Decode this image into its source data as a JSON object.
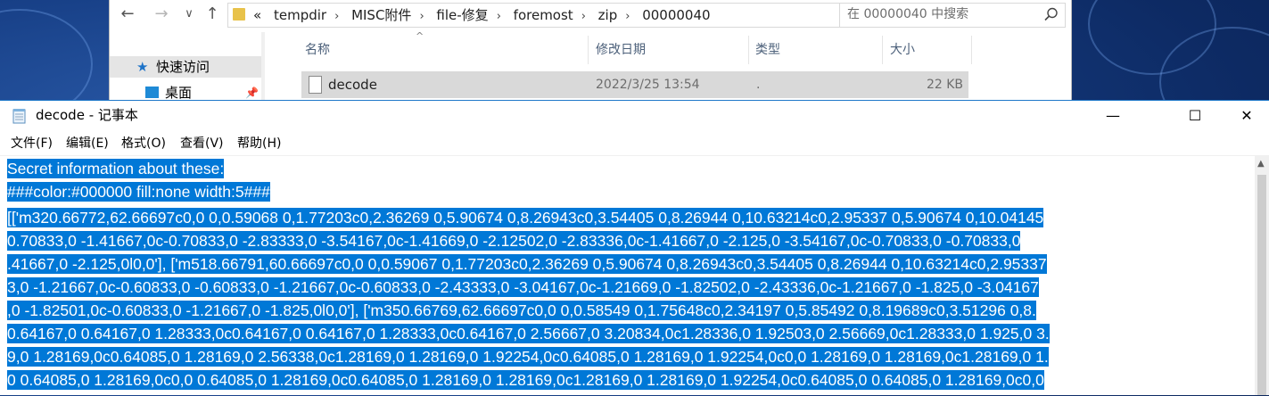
{
  "explorer": {
    "nav": {
      "back": "←",
      "forward": "→",
      "recent": "∨",
      "up": "↑"
    },
    "breadcrumb": [
      "«",
      "tempdir",
      "MISC附件",
      "file-修复",
      "foremost",
      "zip",
      "00000040"
    ],
    "search_placeholder": "在 00000040 中搜索",
    "sidebar": [
      {
        "label": "快速访问",
        "icon": "star-icon"
      },
      {
        "label": "桌面",
        "icon": "desktop-icon"
      }
    ],
    "columns": {
      "name": "名称",
      "modified": "修改日期",
      "type": "类型",
      "size": "大小"
    },
    "files": [
      {
        "name": "decode",
        "modified": "2022/3/25 13:54",
        "type": ".",
        "size": "22 KB"
      }
    ]
  },
  "notepad": {
    "title": "decode - 记事本",
    "controls": {
      "minimize": "—",
      "maximize": "☐",
      "close": "✕"
    },
    "menu": [
      "文件(F)",
      "编辑(E)",
      "格式(O)",
      "查看(V)",
      "帮助(H)"
    ],
    "lines": [
      "Secret information about these:",
      "###color:#000000 fill:none width:5###",
      "[['m320.66772,62.66697c0,0 0,0.59068 0,1.77203c0,2.36269 0,5.90674 0,8.26943c0,3.54405 0,8.26944 0,10.63214c0,2.95337 0,5.90674 0,10.04145",
      "0.70833,0 -1.41667,0c-0.70833,0 -2.83333,0 -3.54167,0c-1.41669,0 -2.12502,0 -2.83336,0c-1.41667,0 -2.125,0 -3.54167,0c-0.70833,0 -0.70833,0",
      ".41667,0 -2.125,0l0,0'], ['m518.66791,60.66697c0,0 0,0.59067 0,1.77203c0,2.36269 0,5.90674 0,8.26943c0,3.54405 0,8.26944 0,10.63214c0,2.95337",
      "3,0 -1.21667,0c-0.60833,0 -0.60833,0 -1.21667,0c-0.60833,0 -2.43333,0 -3.04167,0c-1.21669,0 -1.82502,0 -2.43336,0c-1.21667,0 -1.825,0 -3.04167",
      ",0 -1.82501,0c-0.60833,0 -1.21667,0 -1.825,0l0,0'], ['m350.66769,62.66697c0,0 0,0.58549 0,1.75648c0,2.34197 0,5.85492 0,8.19689c0,3.51296 0,8.",
      "0.64167,0 0.64167,0 1.28333,0c0.64167,0 0.64167,0 1.28333,0c0.64167,0 2.56667,0 3.20834,0c1.28336,0 1.92503,0 2.56669,0c1.28333,0 1.925,0 3.",
      "9,0 1.28169,0c0.64085,0 1.28169,0 2.56338,0c1.28169,0 1.28169,0 1.92254,0c0.64085,0 1.28169,0 1.92254,0c0,0 1.28169,0 1.28169,0c1.28169,0 1.",
      "0 0.64085,0 1.28169,0c0,0 0.64085,0 1.28169,0c0.64085,0 1.28169,0 1.28169,0c1.28169,0 1.28169,0 1.92254,0c0.64085,0 0.64085,0 1.28169,0c0,0"
    ]
  }
}
